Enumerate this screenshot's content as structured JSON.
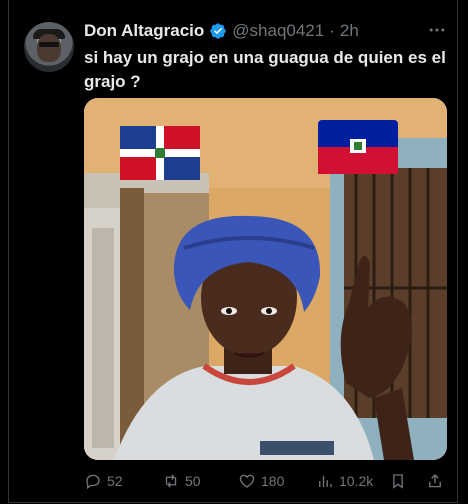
{
  "tweet": {
    "author_name": "Don Altagracio",
    "handle": "@shaq0421",
    "separator": "·",
    "time": "2h",
    "text": "si hay un grajo en una guagua de quien es el grajo ?",
    "more_icon": "more-horizontal-icon",
    "verified_icon": "verified-badge-icon",
    "accent_color": "#1d9bf0"
  },
  "actions": {
    "replies": "52",
    "reposts": "50",
    "likes": "180",
    "views": "10.2k"
  },
  "colors": {
    "background": "#000000",
    "text_primary": "#e7e9ea",
    "text_secondary": "#71767b",
    "divider": "#2f3336"
  }
}
